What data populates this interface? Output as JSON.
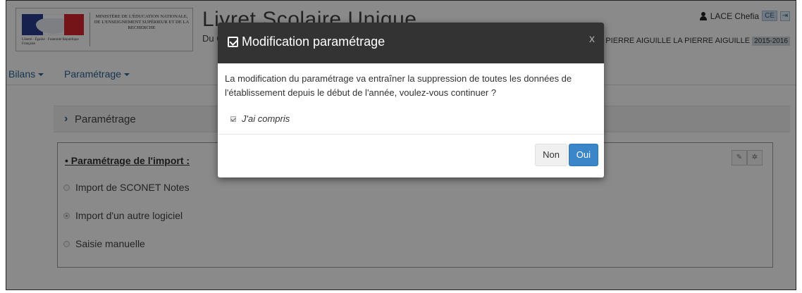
{
  "header": {
    "ministry_lines": "Ministère de l'Éducation nationale, de l'Enseignement supérieur et de la Recherche",
    "republic_text": "Liberté · Égalité · Fraternité République Française",
    "app_title": "Livret Scolaire Unique",
    "app_subtitle": "Du C",
    "user_name": "LACE Chefia",
    "role_badge": "CE",
    "school_name": "LA PIERRE AIGUILLE LA PIERRE AIGUILLE",
    "year": "2015-2016"
  },
  "nav": {
    "bilans": "Bilans",
    "parametrage": "Paramétrage"
  },
  "main": {
    "section_title": "Paramétrage",
    "panel_title": "• Paramétrage de l'import :",
    "options": [
      {
        "label": "Import de SCONET Notes",
        "selected": false
      },
      {
        "label": "Import d'un autre logiciel",
        "selected": true
      },
      {
        "label": "Saisie manuelle",
        "selected": false
      }
    ],
    "icons": [
      "pencil-icon",
      "spinner-icon"
    ]
  },
  "modal": {
    "title": "Modification paramétrage",
    "close": "x",
    "message": "La modification du paramétrage va entraîner la suppression de toutes les données de l'établissement depuis le début de l'année, voulez-vous continuer ?",
    "checkbox_label": "J'ai compris",
    "checkbox_checked": true,
    "btn_no": "Non",
    "btn_yes": "Oui"
  },
  "colors": {
    "link": "#2a6496",
    "modal_header": "#333333",
    "primary_button": "#3a86c8"
  }
}
